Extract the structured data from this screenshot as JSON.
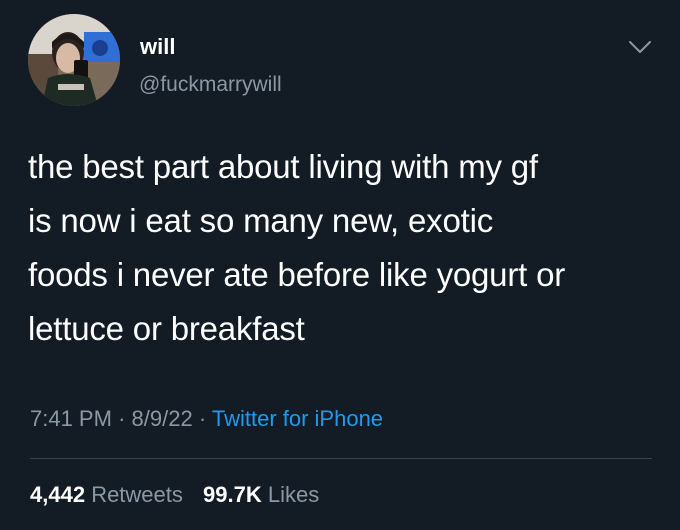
{
  "tweet": {
    "author": {
      "name": "will",
      "handle": "@fuckmarrywill",
      "avatar_icon": "profile-photo"
    },
    "menu_icon": "chevron-down-icon",
    "text_lines": [
      "the best part about living with my gf",
      "is now i eat so many new, exotic",
      "foods i never ate before like yogurt or",
      "lettuce or breakfast"
    ],
    "time": "7:41 PM",
    "date": "8/9/22",
    "separator": "·",
    "source": "Twitter for iPhone",
    "retweets": {
      "count": "4,442",
      "label": "Retweets"
    },
    "likes": {
      "count": "99.7K",
      "label": "Likes"
    },
    "colors": {
      "background": "#131b24",
      "primary_text": "#ffffff",
      "secondary_text": "#8b98a5",
      "link": "#1d9bf0",
      "divider": "#38444d"
    }
  }
}
